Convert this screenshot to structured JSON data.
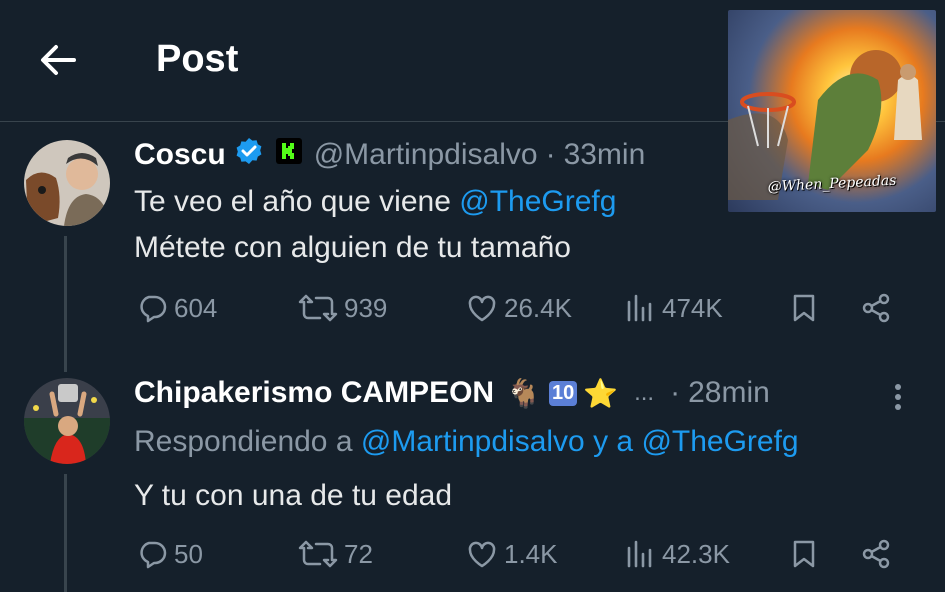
{
  "header": {
    "title": "Post"
  },
  "watermark": {
    "text": "@When_Pepeadas"
  },
  "tweet1": {
    "name": "Coscu",
    "handle": "@Martinpdisalvo",
    "separator": "·",
    "time": "33min",
    "line1_text": "Te veo el año que viene ",
    "line1_mention": "@TheGrefg",
    "line2_text": "Métete con alguien de tu tamaño",
    "replies": "604",
    "reposts": "939",
    "likes": "26.4K",
    "views": "474K"
  },
  "tweet2": {
    "name": "Chipakerismo CAMPEON",
    "name_emojis": "🐐",
    "badge_ten": "10",
    "star": "⭐",
    "ellipsis": "...",
    "separator": "·",
    "time": "28min",
    "reply_prefix": "Respondiendo a ",
    "reply_to_1": "@Martinpdisalvo",
    "reply_connector": " y a ",
    "reply_to_2": "@TheGrefg",
    "text": "Y tu con una de tu edad",
    "replies": "50",
    "reposts": "72",
    "likes": "1.4K",
    "views": "42.3K"
  },
  "colors": {
    "background": "#15202b",
    "accent": "#1d9bf0",
    "muted": "#8b98a5",
    "divider": "#38444d"
  }
}
